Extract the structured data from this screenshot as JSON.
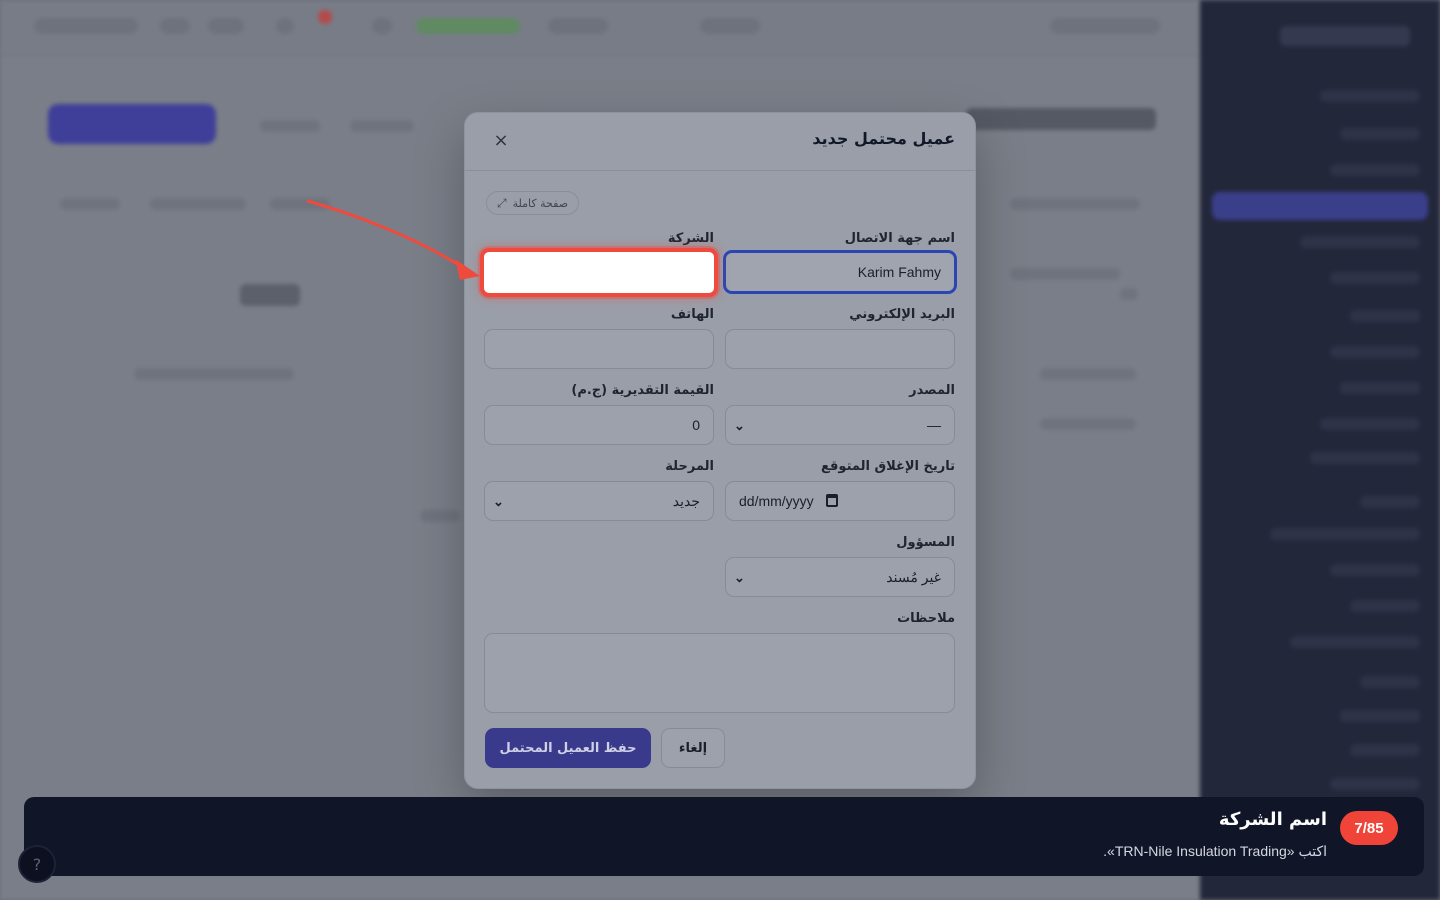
{
  "modal": {
    "title": "عميل محتمل جديد",
    "close_label": "×",
    "fullpage_label": "صفحة كاملة",
    "fields": {
      "contact_name": {
        "label": "اسم جهة الاتصال",
        "value": "Karim Fahmy"
      },
      "company": {
        "label": "الشركة",
        "value": ""
      },
      "email": {
        "label": "البريد الإلكتروني",
        "value": ""
      },
      "phone": {
        "label": "الهاتف",
        "value": ""
      },
      "source": {
        "label": "المصدر",
        "value": "—"
      },
      "estimated_value": {
        "label": "القيمة التقديرية (ج.م)",
        "value": "0"
      },
      "close_date": {
        "label": "تاريخ الإغلاق المتوقع",
        "value": "dd/mm/yyyy"
      },
      "stage": {
        "label": "المرحلة",
        "value": "جديد"
      },
      "owner": {
        "label": "المسؤول",
        "value": "غير مُسند"
      },
      "notes": {
        "label": "ملاحظات",
        "value": ""
      }
    },
    "buttons": {
      "save": "حفظ العميل المحتمل",
      "cancel": "إلغاء"
    }
  },
  "tutorial": {
    "step": "7/85",
    "title": "اسم الشركة",
    "instruction": "اكتب «TRN-Nile Insulation Trading».",
    "highlight_color": "#ef4a3e"
  },
  "theme": {
    "accent": "#3a3a8c",
    "focus_border": "#2b46b4",
    "banner_bg": "#111528",
    "badge_bg": "#f04438"
  }
}
